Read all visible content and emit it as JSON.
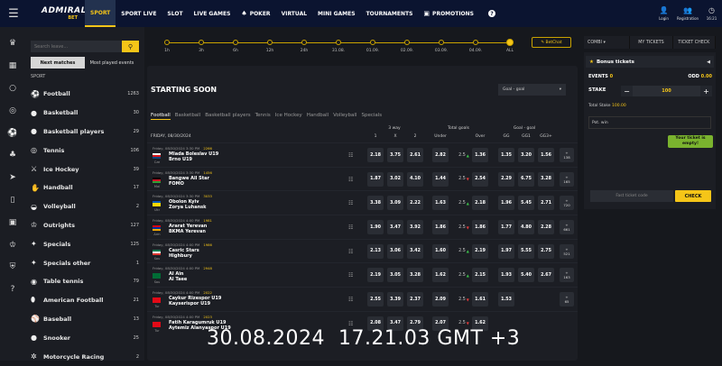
{
  "topbar": {
    "logo_main": "ADMIRAL",
    "logo_sub": "BET",
    "nav": [
      {
        "label": "SPORT",
        "active": true,
        "icon": ""
      },
      {
        "label": "SPORT LIVE",
        "active": false,
        "icon": ""
      },
      {
        "label": "SLOT",
        "active": false,
        "icon": ""
      },
      {
        "label": "LIVE GAMES",
        "active": false,
        "icon": ""
      },
      {
        "label": "POKER",
        "active": false,
        "icon": "spade-icon"
      },
      {
        "label": "VIRTUAL",
        "active": false,
        "icon": ""
      },
      {
        "label": "MINI GAMES",
        "active": false,
        "icon": ""
      },
      {
        "label": "TOURNAMENTS",
        "active": false,
        "icon": ""
      },
      {
        "label": "PROMOTIONS",
        "active": false,
        "icon": "gift-icon"
      }
    ],
    "login": "Login",
    "registration": "Registration",
    "time": "16:21"
  },
  "sidebar": {
    "search_placeholder": "Search leave...",
    "tab_next": "Next matches",
    "tab_most": "Most played events",
    "sport_header": "SPORT",
    "items": [
      {
        "label": "Football",
        "count": "1263",
        "icon": "football-icon"
      },
      {
        "label": "Basketball",
        "count": "30",
        "icon": "basketball-icon"
      },
      {
        "label": "Basketball players",
        "count": "29",
        "icon": "basketball-icon"
      },
      {
        "label": "Tennis",
        "count": "106",
        "icon": "tennis-icon"
      },
      {
        "label": "Ice Hockey",
        "count": "39",
        "icon": "hockey-icon"
      },
      {
        "label": "Handball",
        "count": "17",
        "icon": "handball-icon"
      },
      {
        "label": "Volleyball",
        "count": "2",
        "icon": "volleyball-icon"
      },
      {
        "label": "Outrights",
        "count": "127",
        "icon": "trophy-icon"
      },
      {
        "label": "Specials",
        "count": "125",
        "icon": "specials-icon"
      },
      {
        "label": "Specials other",
        "count": "1",
        "icon": "specials-icon"
      },
      {
        "label": "Table tennis",
        "count": "79",
        "icon": "table-tennis-icon"
      },
      {
        "label": "American Football",
        "count": "21",
        "icon": "american-football-icon"
      },
      {
        "label": "Baseball",
        "count": "13",
        "icon": "baseball-icon"
      },
      {
        "label": "Snooker",
        "count": "25",
        "icon": "snooker-icon"
      },
      {
        "label": "Motorcycle Racing",
        "count": "2",
        "icon": "motorcycle-icon"
      }
    ]
  },
  "timeline": {
    "labels": [
      "1h",
      "3h",
      "6h",
      "12h",
      "24h",
      "31.08.",
      "01.09.",
      "02.09.",
      "03.09.",
      "04.09.",
      "ALL"
    ],
    "betchat": "BetChat"
  },
  "panel": {
    "title": "STARTING SOON",
    "select_value": "Goal - goal",
    "sport_tabs": [
      "Football",
      "Basketball",
      "Basketball players",
      "Tennis",
      "Ice Hockey",
      "Handball",
      "Volleyball",
      "Specials"
    ],
    "date": "FRIDAY, 08/30/2024",
    "group_3way": "3 way",
    "group_total": "Total goals",
    "group_gg": "Goal - goal",
    "cols": [
      "1",
      "X",
      "2",
      "Under",
      "",
      "Over",
      "GG",
      "GG1",
      "GG3+"
    ]
  },
  "matches": [
    {
      "time": "Friday, 08/30/2024 3:30 PM",
      "id": "2266",
      "team1": "Mlada Boleslav U19",
      "team2": "Brno U19",
      "flag": "Cze",
      "o1": "2.18",
      "ox": "3.75",
      "o2": "2.61",
      "under": "2.82",
      "line": "2.5",
      "dir": "up",
      "over": "1.36",
      "gg": "1.35",
      "gg1": "3.20",
      "gg3": "1.56",
      "more": "138"
    },
    {
      "time": "Friday, 08/30/2024 3:30 PM",
      "id": "1456",
      "team1": "Bangwe All Star",
      "team2": "FOMO",
      "flag": "Mal",
      "o1": "1.87",
      "ox": "3.02",
      "o2": "4.10",
      "under": "1.44",
      "line": "2.5",
      "dir": "dn",
      "over": "2.54",
      "gg": "2.29",
      "gg1": "6.75",
      "gg3": "3.28",
      "more": "165"
    },
    {
      "time": "Friday, 08/30/2024 3:30 PM",
      "id": "3033",
      "team1": "Obolon Kyiv",
      "team2": "Zorya Luhansk",
      "flag": "Ukr",
      "o1": "3.38",
      "ox": "3.09",
      "o2": "2.22",
      "under": "1.63",
      "line": "2.5",
      "dir": "up",
      "over": "2.18",
      "gg": "1.96",
      "gg1": "5.45",
      "gg3": "2.71",
      "more": "720"
    },
    {
      "time": "Friday, 08/30/2024 4:00 PM",
      "id": "1981",
      "team1": "Ararat Yerevan",
      "team2": "BKMA Yerevan",
      "flag": "Arm",
      "o1": "1.90",
      "ox": "3.47",
      "o2": "3.92",
      "under": "1.86",
      "line": "2.5",
      "dir": "dn",
      "over": "1.86",
      "gg": "1.77",
      "gg1": "4.80",
      "gg3": "2.28",
      "more": "661"
    },
    {
      "time": "Friday, 08/30/2024 4:00 PM",
      "id": "1986",
      "team1": "Casric Stars",
      "team2": "Highbury",
      "flag": "Sou",
      "o1": "2.13",
      "ox": "3.06",
      "o2": "3.42",
      "under": "1.60",
      "line": "2.5",
      "dir": "up",
      "over": "2.19",
      "gg": "1.97",
      "gg1": "5.55",
      "gg3": "2.75",
      "more": "521"
    },
    {
      "time": "Friday, 08/30/2024 4:00 PM",
      "id": "2948",
      "team1": "Al Ain",
      "team2": "Al Taee",
      "flag": "Sau",
      "o1": "2.19",
      "ox": "3.05",
      "o2": "3.28",
      "under": "1.62",
      "line": "2.5",
      "dir": "up",
      "over": "2.15",
      "gg": "1.93",
      "gg1": "5.40",
      "gg3": "2.67",
      "more": "163"
    },
    {
      "time": "Friday, 08/30/2024 4:00 PM",
      "id": "2022",
      "team1": "Caykur Rizespor U19",
      "team2": "Kayserispor U19",
      "flag": "Tur",
      "o1": "2.55",
      "ox": "3.39",
      "o2": "2.37",
      "under": "2.09",
      "line": "2.5",
      "dir": "dn",
      "over": "1.61",
      "gg": "1.53",
      "gg1": "",
      "gg3": "",
      "more": "65"
    },
    {
      "time": "Friday, 08/30/2024 4:00 PM",
      "id": "2023",
      "team1": "Fatih Karagumruk U19",
      "team2": "Aytemiz Alanyaspor U19",
      "flag": "Tur",
      "o1": "2.08",
      "ox": "3.47",
      "o2": "2.79",
      "under": "2.07",
      "line": "2.5",
      "dir": "dn",
      "over": "1.62",
      "gg": "",
      "gg1": "",
      "gg3": "",
      "more": ""
    }
  ],
  "betslip": {
    "tab_combi": "COMBI",
    "tab_my": "MY TICKETS",
    "tab_check": "TICKET CHECK",
    "bonus": "Bonus tickets",
    "events_label": "EVENTS",
    "events_value": "0",
    "odd_label": "ODD",
    "odd_value": "0.00",
    "stake_label": "STAKE",
    "stake_value": "100",
    "total_stake_label": "Total Stake",
    "total_stake_value": "100.00",
    "pot_win": "Pot. win",
    "empty_msg": "Your ticket is empty!",
    "fast_placeholder": "Fast ticket code",
    "check_label": "CHECK"
  },
  "overlay_timestamp": "30.08.2024  17.21.03 GMT +3"
}
